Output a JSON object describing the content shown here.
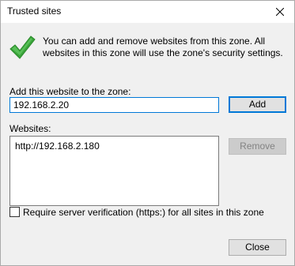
{
  "window": {
    "title": "Trusted sites"
  },
  "icons": {
    "close": "close-icon",
    "check": "check-icon"
  },
  "info": {
    "text": "You can add and remove websites from this zone. All websites in this zone will use the zone's security settings."
  },
  "add_site": {
    "label": "Add this website to the zone:",
    "value": "192.168.2.20",
    "button": "Add"
  },
  "websites": {
    "label": "Websites:",
    "items": [
      "http://192.168.2.180"
    ],
    "remove_button": "Remove"
  },
  "https_option": {
    "label": "Require server verification (https:) for all sites in this zone",
    "checked": false
  },
  "footer": {
    "close_button": "Close"
  },
  "colors": {
    "accent": "#0078d7",
    "check_green": "#3aa43a",
    "client_bg": "#f0f0f0"
  }
}
